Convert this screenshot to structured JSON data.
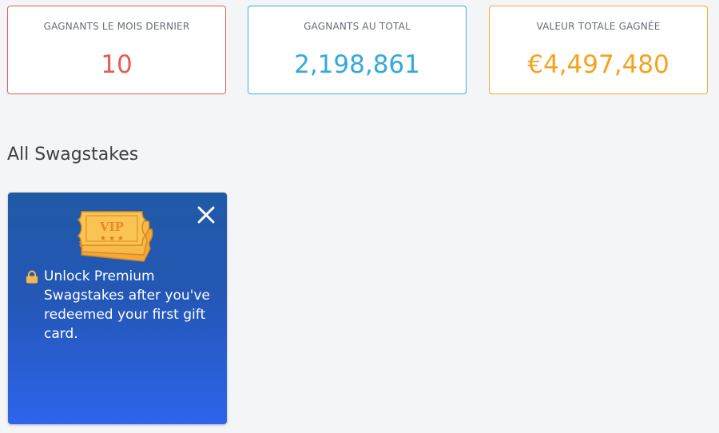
{
  "stats": {
    "last_month": {
      "label": "GAGNANTS LE MOIS DERNIER",
      "value": "10"
    },
    "total": {
      "label": "GAGNANTS AU TOTAL",
      "value": "2,198,861"
    },
    "total_value": {
      "label": "VALEUR TOTALE GAGNÉE",
      "value": "€4,497,480"
    }
  },
  "section": {
    "title": "All Swagstakes"
  },
  "premium_card": {
    "ticket_text": "VIP",
    "message": "Unlock Premium Swagstakes after you've redeemed your first gift card."
  },
  "icons": [
    "vip-ticket-icon",
    "close-icon",
    "lock-icon"
  ],
  "colors": {
    "red": "#e25d56",
    "blue": "#3ab0e2",
    "orange": "#f2a92c",
    "card_gradient_top": "#1f5aa5",
    "card_gradient_bottom": "#2d64ec"
  }
}
